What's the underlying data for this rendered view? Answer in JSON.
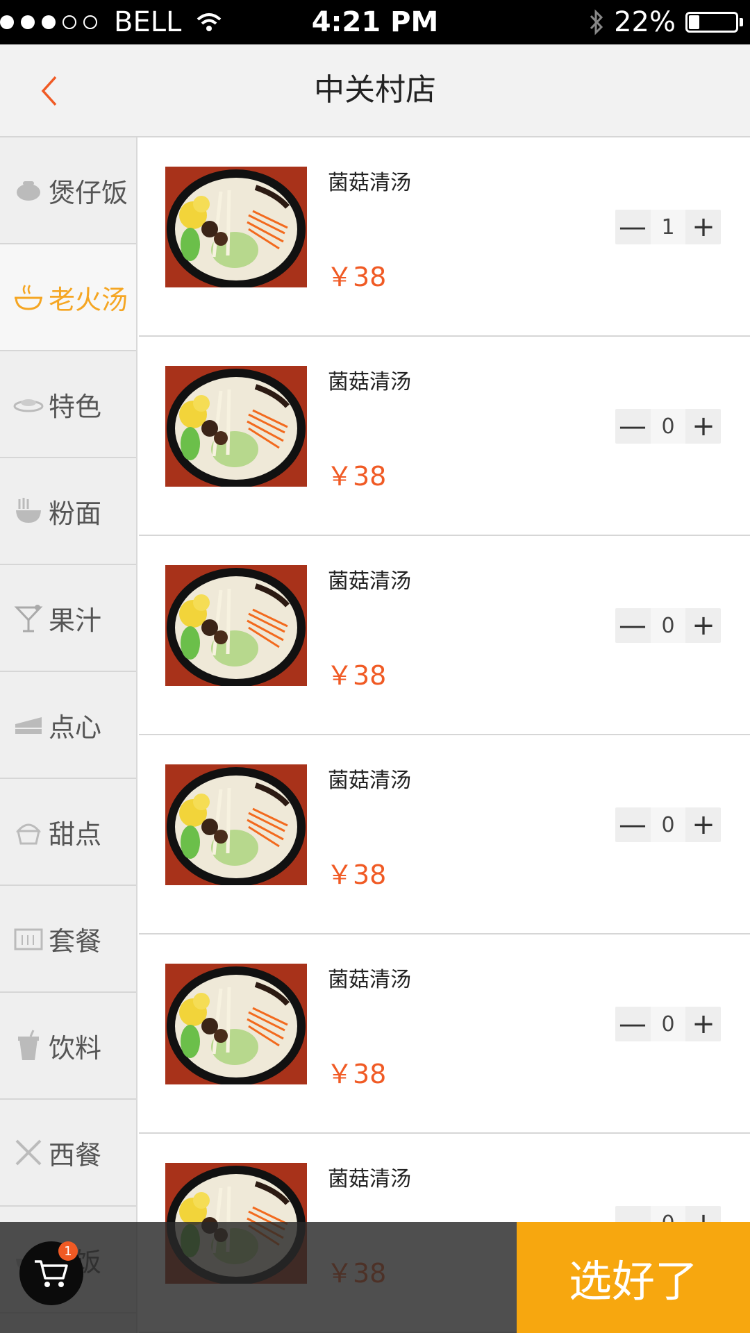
{
  "status_bar": {
    "carrier": "BELL",
    "time": "4:21 PM",
    "battery": "22%",
    "battery_level": 0.22
  },
  "nav": {
    "back_icon": "chevron-left-icon",
    "title": "中关村店"
  },
  "colors": {
    "accent_orange": "#f5a623",
    "price_red": "#f05a24",
    "confirm_bg": "#f7a70f"
  },
  "categories": [
    {
      "label": "煲仔饭",
      "icon": "claypot-icon",
      "active": false
    },
    {
      "label": "老火汤",
      "icon": "soup-bowl-icon",
      "active": true
    },
    {
      "label": "特色",
      "icon": "dish-icon",
      "active": false
    },
    {
      "label": "粉面",
      "icon": "noodle-bowl-icon",
      "active": false
    },
    {
      "label": "果汁",
      "icon": "cocktail-glass-icon",
      "active": false
    },
    {
      "label": "点心",
      "icon": "cake-slice-icon",
      "active": false
    },
    {
      "label": "甜点",
      "icon": "cupcake-icon",
      "active": false
    },
    {
      "label": "套餐",
      "icon": "set-box-icon",
      "active": false
    },
    {
      "label": "饮料",
      "icon": "drink-cup-icon",
      "active": false
    },
    {
      "label": "西餐",
      "icon": "fork-knife-icon",
      "active": false
    },
    {
      "label": "烧饭",
      "icon": "rice-icon",
      "active": false
    }
  ],
  "foods": [
    {
      "name": "菌菇清汤",
      "price": "￥38",
      "qty": "1"
    },
    {
      "name": "菌菇清汤",
      "price": "￥38",
      "qty": "0"
    },
    {
      "name": "菌菇清汤",
      "price": "￥38",
      "qty": "0"
    },
    {
      "name": "菌菇清汤",
      "price": "￥38",
      "qty": "0"
    },
    {
      "name": "菌菇清汤",
      "price": "￥38",
      "qty": "0"
    },
    {
      "name": "菌菇清汤",
      "price": "￥38",
      "qty": "0"
    }
  ],
  "stepper": {
    "minus": "—",
    "plus": "+"
  },
  "cart": {
    "badge": "1",
    "icon": "shopping-cart-icon"
  },
  "confirm_label": "选好了"
}
